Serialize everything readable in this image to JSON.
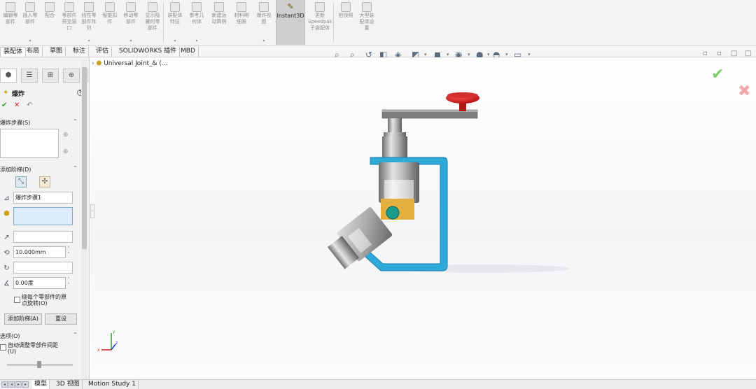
{
  "ribbon": {
    "buttons": [
      {
        "label": "编辑零\n部件",
        "icon": "edit-component-icon"
      },
      {
        "label": "插入零\n部件",
        "icon": "insert-component-icon"
      },
      {
        "label": "配合",
        "icon": "mate-icon"
      },
      {
        "label": "零部件\n预览窗\n口",
        "icon": "component-preview-icon"
      },
      {
        "label": "线性零\n部件阵\n列",
        "icon": "linear-pattern-icon"
      },
      {
        "label": "智能扣\n件",
        "icon": "smart-fastener-icon"
      },
      {
        "label": "移动零\n部件",
        "icon": "move-component-icon"
      },
      {
        "label": "显示隐\n藏的零\n部件",
        "icon": "show-hidden-icon"
      },
      {
        "label": "装配体\n特征",
        "icon": "assembly-feature-icon"
      },
      {
        "label": "参考几\n何体",
        "icon": "reference-geometry-icon"
      },
      {
        "label": "新建运\n动算例",
        "icon": "motion-study-icon"
      },
      {
        "label": "材料明\n细表",
        "icon": "bom-icon"
      },
      {
        "label": "爆炸视\n图",
        "icon": "exploded-view-icon"
      },
      {
        "label": "Instant3D",
        "icon": "instant3d-icon"
      },
      {
        "label": "更新\nSpeedpak\n子装配体",
        "icon": "speedpak-icon"
      },
      {
        "label": "拍快照",
        "icon": "snapshot-icon"
      },
      {
        "label": "大型装\n配体设\n置",
        "icon": "large-assembly-icon"
      }
    ]
  },
  "tabs": [
    "装配体",
    "布局",
    "草图",
    "标注",
    "评估",
    "SOLIDWORKS 插件",
    "MBD"
  ],
  "panel": {
    "title": "爆炸",
    "help": "?",
    "ok": "✔",
    "cancel": "✕",
    "undo": "↶",
    "steps_header": "爆炸步骤(S)",
    "add_step_header": "添加阶梯(D)",
    "step_name": "爆炸步骤1",
    "distance": "10.000mm",
    "angle": "0.00度",
    "rotate_label": "绕每个零部件的原\n点旋转(O)",
    "add_step_button": "添加阶梯(A)",
    "reset_button": "重设",
    "options_header": "选项(O)",
    "auto_space_label": "自动调整零部件间距\n(U)"
  },
  "viewport": {
    "tree_item": "Universal Joint_& (...",
    "triad": {
      "x": "x",
      "y": "y",
      "z": "z"
    }
  },
  "bottom_tabs": [
    "模型",
    "3D 视图",
    "Motion Study 1"
  ],
  "colors": {
    "accent_blue": "#2ea9d9",
    "handle_red": "#d21f1f",
    "pin_teal": "#1a9a8a",
    "ribbon_bg": "#f3f3f3"
  }
}
